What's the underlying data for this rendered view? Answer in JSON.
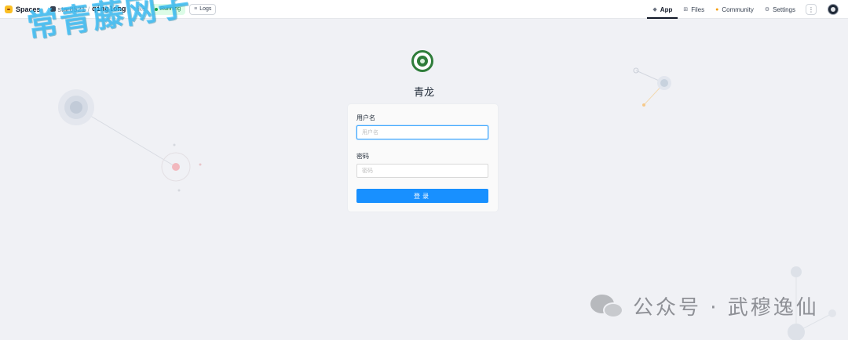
{
  "nav": {
    "brand": "Spaces",
    "owner": "star8521",
    "separator": "/",
    "repo": "qinglong",
    "like_label": "♡ like",
    "status": "Running",
    "logs": "Logs",
    "tabs": [
      {
        "label": "App",
        "icon": "app-icon"
      },
      {
        "label": "Files",
        "icon": "files-icon"
      },
      {
        "label": "Community",
        "icon": "community-icon"
      },
      {
        "label": "Settings",
        "icon": "gear-icon"
      }
    ],
    "more": "⋮"
  },
  "watermark": "常青藤网子",
  "app": {
    "title": "青龙",
    "username_label": "用户名",
    "username_placeholder": "用户名",
    "password_label": "密码",
    "password_placeholder": "密码",
    "login_button": "登录"
  },
  "footer": {
    "wechat_text": "公众号 · 武穆逸仙"
  },
  "colors": {
    "primary": "#1890ff",
    "focus_border": "#40a9ff",
    "running": "#16a34a",
    "logo": "#2f7d3a",
    "background": "#f0f1f5"
  }
}
